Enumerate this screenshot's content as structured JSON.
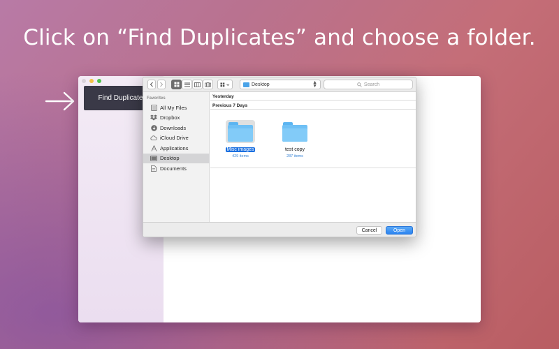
{
  "headline": "Click on “Find Duplicates” and choose a folder.",
  "app": {
    "find_button_label": "Find Duplicates"
  },
  "dialog": {
    "location": "Desktop",
    "search_placeholder": "Search",
    "favorites_header": "Favorites",
    "favorites": [
      {
        "label": "All My Files",
        "icon": "all-files-icon"
      },
      {
        "label": "Dropbox",
        "icon": "dropbox-icon"
      },
      {
        "label": "Downloads",
        "icon": "downloads-icon"
      },
      {
        "label": "iCloud Drive",
        "icon": "cloud-icon"
      },
      {
        "label": "Applications",
        "icon": "applications-icon"
      },
      {
        "label": "Desktop",
        "icon": "desktop-icon",
        "selected": true
      },
      {
        "label": "Documents",
        "icon": "documents-icon"
      }
    ],
    "sections": {
      "yesterday": "Yesterday",
      "previous": "Previous 7 Days"
    },
    "folders": [
      {
        "name": "Misc images",
        "count": "429 items",
        "selected": true
      },
      {
        "name": "test copy",
        "count": "287 items",
        "selected": false
      }
    ],
    "cancel_label": "Cancel",
    "open_label": "Open"
  },
  "colors": {
    "accent": "#2c84f0",
    "folder": "#6fc0f5",
    "find_button_bg": "#3a3947"
  }
}
